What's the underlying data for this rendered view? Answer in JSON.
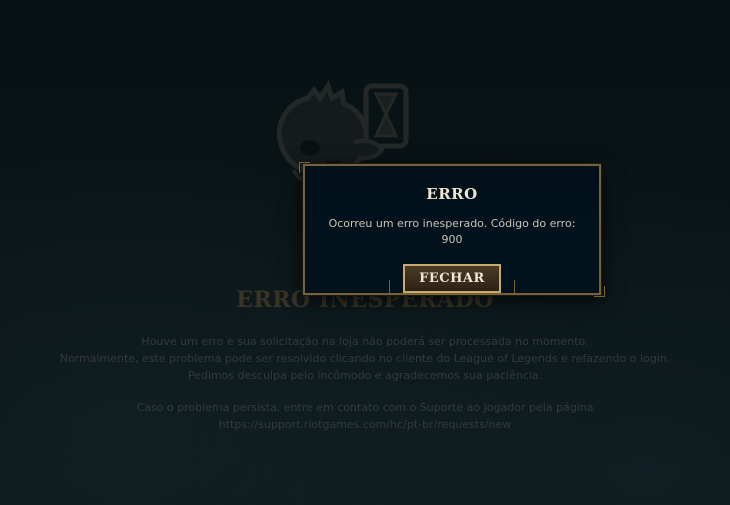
{
  "background": {
    "title": "ERRO INESPERADO",
    "lines": [
      "Houve um erro e sua solicitação na loja não poderá ser processada no momento.",
      "Normalmente, este problema pode ser resolvido clicando no cliente do League of Legends e refazendo o login.",
      "Pedimos desculpa pelo incômodo e agradecemos sua paciência.",
      "Caso o problema persista, entre em contato com o Suporte ao Jogador pela página",
      "https://support.riotgames.com/hc/pt-br/requests/new"
    ],
    "illustration_icon": "poro-hourglass-icon"
  },
  "modal": {
    "title": "ERRO",
    "message": "Ocorreu um erro inesperado. Código do erro: 900",
    "close_label": "FECHAR"
  },
  "colors": {
    "gold_border": "#786238",
    "button_border": "#c8aa6e",
    "modal_bg": "#01101a",
    "page_bg": "#071012"
  }
}
